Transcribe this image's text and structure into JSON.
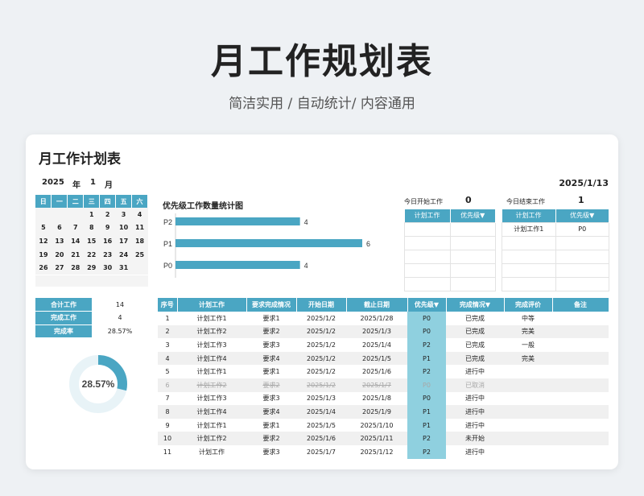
{
  "hero": {
    "title": "月工作规划表",
    "subtitle": "简洁实用 / 自动统计/ 内容通用"
  },
  "sheet": {
    "title": "月工作计划表",
    "year": "2025",
    "year_unit": "年",
    "month": "1",
    "month_unit": "月",
    "today": "2025/1/13"
  },
  "calendar": {
    "weekdays": [
      "日",
      "一",
      "二",
      "三",
      "四",
      "五",
      "六"
    ],
    "weeks": [
      [
        "",
        "",
        "",
        "1",
        "2",
        "3",
        "4"
      ],
      [
        "5",
        "6",
        "7",
        "8",
        "9",
        "10",
        "11"
      ],
      [
        "12",
        "13",
        "14",
        "15",
        "16",
        "17",
        "18"
      ],
      [
        "19",
        "20",
        "21",
        "22",
        "23",
        "24",
        "25"
      ],
      [
        "26",
        "27",
        "28",
        "29",
        "30",
        "31",
        ""
      ]
    ]
  },
  "chart_data": {
    "type": "bar",
    "title": "优先级工作数量统计图",
    "categories": [
      "P2",
      "P1",
      "P0"
    ],
    "values": [
      4,
      6,
      4
    ],
    "color": "#4aa6c3",
    "xlim": [
      0,
      6
    ]
  },
  "today_start": {
    "label": "今日开始工作",
    "count": "0",
    "headers": [
      "计划工作",
      "优先级▼"
    ],
    "rows": [
      [
        "",
        ""
      ],
      [
        "",
        ""
      ],
      [
        "",
        ""
      ],
      [
        "",
        ""
      ],
      [
        "",
        ""
      ]
    ]
  },
  "today_end": {
    "label": "今日结束工作",
    "count": "1",
    "headers": [
      "计划工作",
      "优先级▼"
    ],
    "rows": [
      [
        "计划工作1",
        "P0"
      ],
      [
        "",
        ""
      ],
      [
        "",
        ""
      ],
      [
        "",
        ""
      ],
      [
        "",
        ""
      ]
    ]
  },
  "summary": {
    "rows": [
      {
        "label": "合计工作",
        "value": "14"
      },
      {
        "label": "完成工作",
        "value": "4"
      },
      {
        "label": "完成率",
        "value": "28.57%"
      }
    ],
    "rate_text": "28.57%",
    "rate_value": 0.2857,
    "accent": "#4aa6c3",
    "track": "#e8f3f7"
  },
  "tasks": {
    "headers": [
      "序号",
      "计划工作",
      "要求完成情况",
      "开始日期",
      "截止日期",
      "优先级▼",
      "完成情况▼",
      "完成评价",
      "备注"
    ],
    "rows": [
      {
        "no": "1",
        "task": "计划工作1",
        "req": "要求1",
        "start": "2025/1/2",
        "end": "2025/1/28",
        "pri": "P0",
        "status": "已完成",
        "eval": "中等",
        "note": "",
        "cancel": false
      },
      {
        "no": "2",
        "task": "计划工作2",
        "req": "要求2",
        "start": "2025/1/2",
        "end": "2025/1/3",
        "pri": "P0",
        "status": "已完成",
        "eval": "完美",
        "note": "",
        "cancel": false
      },
      {
        "no": "3",
        "task": "计划工作3",
        "req": "要求3",
        "start": "2025/1/2",
        "end": "2025/1/4",
        "pri": "P2",
        "status": "已完成",
        "eval": "一般",
        "note": "",
        "cancel": false
      },
      {
        "no": "4",
        "task": "计划工作4",
        "req": "要求4",
        "start": "2025/1/2",
        "end": "2025/1/5",
        "pri": "P1",
        "status": "已完成",
        "eval": "完美",
        "note": "",
        "cancel": false
      },
      {
        "no": "5",
        "task": "计划工作1",
        "req": "要求1",
        "start": "2025/1/2",
        "end": "2025/1/6",
        "pri": "P2",
        "status": "进行中",
        "eval": "",
        "note": "",
        "cancel": false
      },
      {
        "no": "6",
        "task": "计划工作2",
        "req": "要求2",
        "start": "2025/1/2",
        "end": "2025/1/7",
        "pri": "P0",
        "status": "已取消",
        "eval": "",
        "note": "",
        "cancel": true
      },
      {
        "no": "7",
        "task": "计划工作3",
        "req": "要求3",
        "start": "2025/1/3",
        "end": "2025/1/8",
        "pri": "P0",
        "status": "进行中",
        "eval": "",
        "note": "",
        "cancel": false
      },
      {
        "no": "8",
        "task": "计划工作4",
        "req": "要求4",
        "start": "2025/1/4",
        "end": "2025/1/9",
        "pri": "P1",
        "status": "进行中",
        "eval": "",
        "note": "",
        "cancel": false
      },
      {
        "no": "9",
        "task": "计划工作1",
        "req": "要求1",
        "start": "2025/1/5",
        "end": "2025/1/10",
        "pri": "P1",
        "status": "进行中",
        "eval": "",
        "note": "",
        "cancel": false
      },
      {
        "no": "10",
        "task": "计划工作2",
        "req": "要求2",
        "start": "2025/1/6",
        "end": "2025/1/11",
        "pri": "P2",
        "status": "未开始",
        "eval": "",
        "note": "",
        "cancel": false
      },
      {
        "no": "11",
        "task": "计划工作",
        "req": "要求3",
        "start": "2025/1/7",
        "end": "2025/1/12",
        "pri": "P2",
        "status": "进行中",
        "eval": "",
        "note": "",
        "cancel": false
      }
    ]
  }
}
